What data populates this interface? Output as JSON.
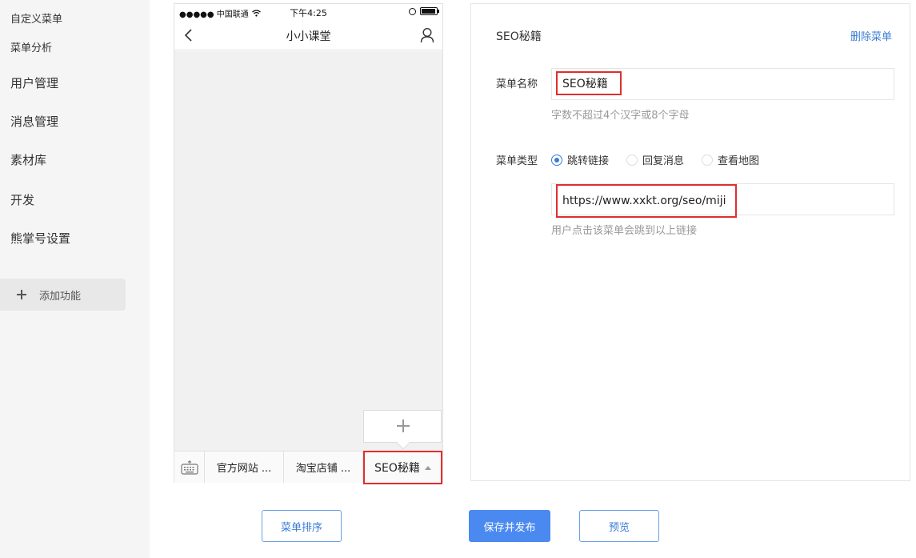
{
  "sidebar": {
    "items": [
      {
        "label": "自定义菜单"
      },
      {
        "label": "菜单分析"
      },
      {
        "label": "用户管理"
      },
      {
        "label": "消息管理"
      },
      {
        "label": "素材库"
      },
      {
        "label": "开发"
      },
      {
        "label": "熊掌号设置"
      }
    ],
    "add_label": "添加功能"
  },
  "phone": {
    "carrier": "●●●●● 中国联通",
    "time": "下午4:25",
    "title": "小小课堂",
    "menu": [
      {
        "label": "官方网站 ..."
      },
      {
        "label": "淘宝店铺 ..."
      },
      {
        "label": "SEO秘籍"
      }
    ]
  },
  "editor": {
    "title": "SEO秘籍",
    "delete_label": "删除菜单",
    "name_label": "菜单名称",
    "name_value": "SEO秘籍",
    "name_hint": "字数不超过4个汉字或8个字母",
    "type_label": "菜单类型",
    "types": [
      {
        "label": "跳转链接",
        "selected": true
      },
      {
        "label": "回复消息",
        "selected": false
      },
      {
        "label": "查看地图",
        "selected": false
      }
    ],
    "url_value": "https://www.xxkt.org/seo/miji",
    "url_hint": "用户点击该菜单会跳到以上链接"
  },
  "actions": {
    "sort_label": "菜单排序",
    "publish_label": "保存并发布",
    "preview_label": "预览"
  },
  "colors": {
    "accent": "#3a7bd5",
    "primary_button": "#4a8af0",
    "highlight": "#e02e2e",
    "sidebar_bg": "#f5f5f5"
  }
}
